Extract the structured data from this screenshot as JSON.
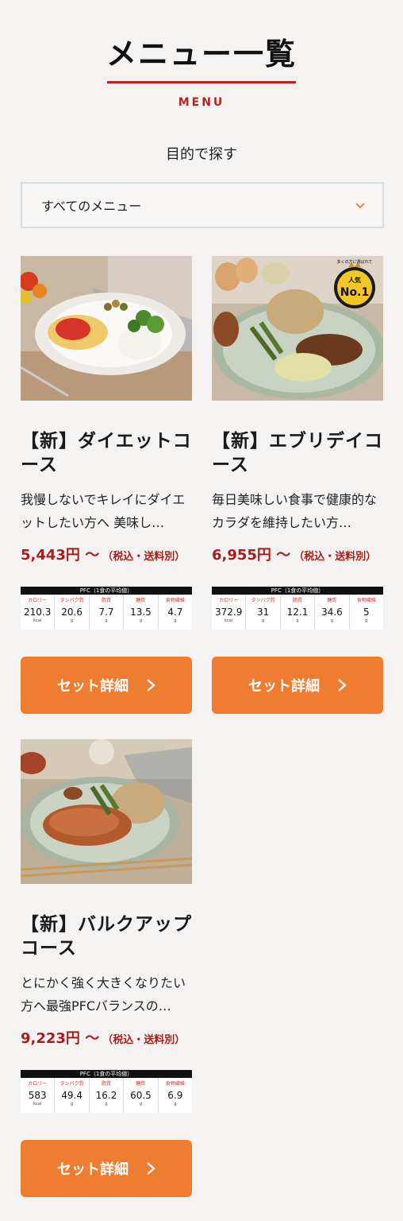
{
  "header": {
    "title": "メニュー一覧",
    "subtitle": "MENU"
  },
  "filter": {
    "label": "目的で探す",
    "selected": "すべてのメニュー"
  },
  "pfc_header": "PFC（1食の平均値）",
  "pfc_labels": [
    "カロリー",
    "タンパク質",
    "脂質",
    "糖質",
    "食物繊維"
  ],
  "colors": {
    "accent": "#b3261e",
    "button": "#ee7d31",
    "price": "#a81c1c"
  },
  "cards": [
    {
      "title": "【新】ダイエットコース",
      "description": "我慢しないでキレイにダイエットしたい方へ 美味し…",
      "price": "5,443円 〜",
      "price_note": "（税込・送料別）",
      "pfc": [
        {
          "value": "210.3",
          "unit": "kcal"
        },
        {
          "value": "20.6",
          "unit": "g"
        },
        {
          "value": "7.7",
          "unit": "g"
        },
        {
          "value": "13.5",
          "unit": "g"
        },
        {
          "value": "4.7",
          "unit": "g"
        }
      ],
      "button": "セット詳細"
    },
    {
      "title": "【新】エブリデイコース",
      "description": "毎日美味しい食事で健康的なカラダを維持したい方…",
      "price": "6,955円 〜",
      "price_note": "（税込・送料別）",
      "badge_top": "多くの方に選ばれて",
      "badge_main": "人気",
      "badge_rank": "No.1",
      "pfc": [
        {
          "value": "372.9",
          "unit": "kcal"
        },
        {
          "value": "31",
          "unit": "g"
        },
        {
          "value": "12.1",
          "unit": "g"
        },
        {
          "value": "34.6",
          "unit": "g"
        },
        {
          "value": "5",
          "unit": "g"
        }
      ],
      "button": "セット詳細"
    },
    {
      "title": "【新】バルクアップコース",
      "description": "とにかく強く大きくなりたい方へ最強PFCバランスの…",
      "price": "9,223円 〜",
      "price_note": "（税込・送料別）",
      "pfc": [
        {
          "value": "583",
          "unit": "kcal"
        },
        {
          "value": "49.4",
          "unit": "g"
        },
        {
          "value": "16.2",
          "unit": "g"
        },
        {
          "value": "60.5",
          "unit": "g"
        },
        {
          "value": "6.9",
          "unit": "g"
        }
      ],
      "button": "セット詳細"
    }
  ]
}
